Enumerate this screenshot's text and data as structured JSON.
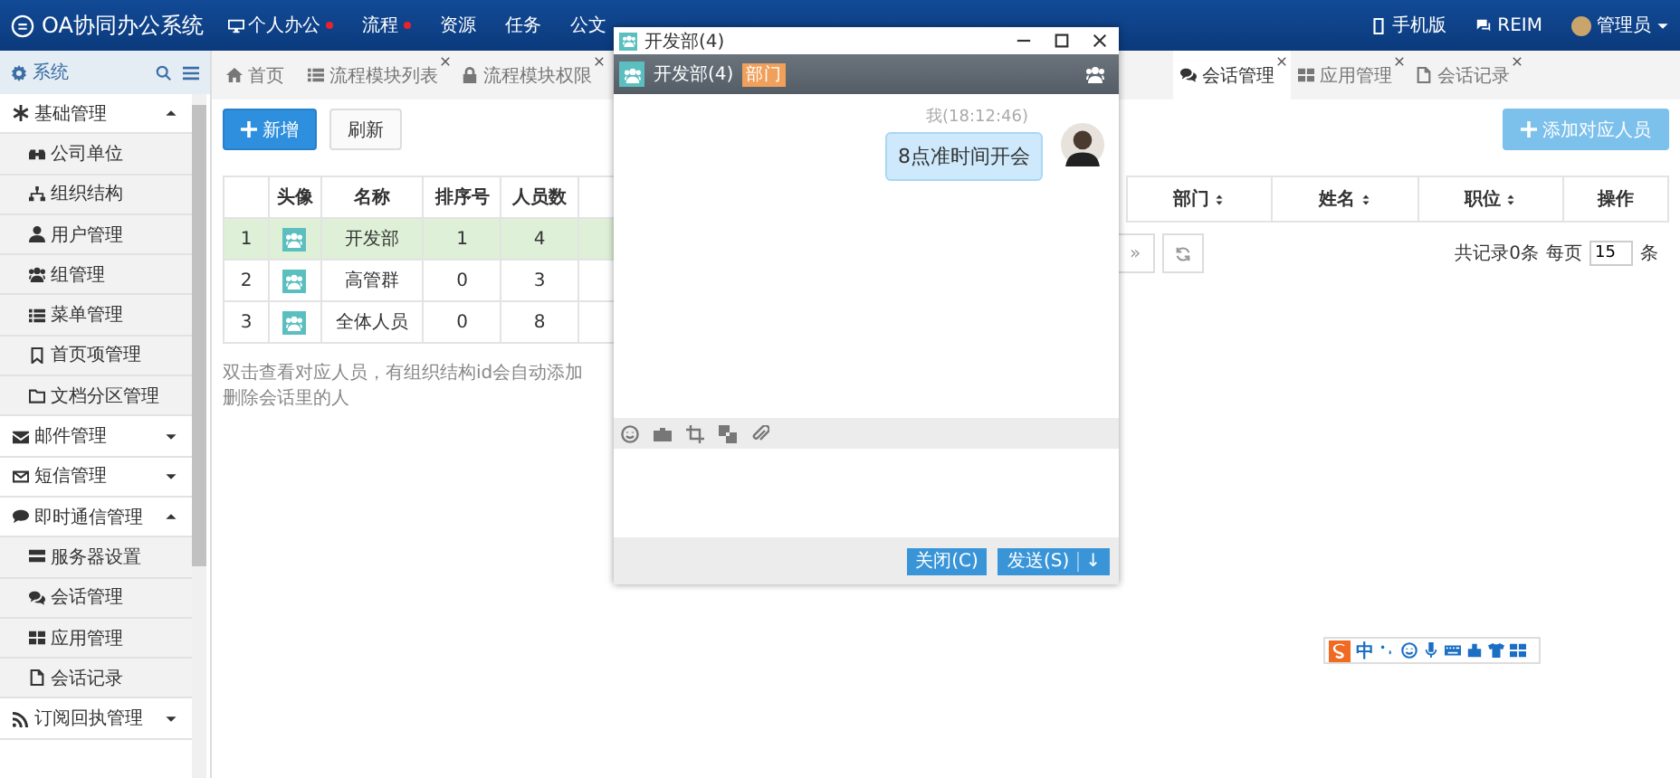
{
  "app": {
    "title": "OA协同办公系统"
  },
  "nav": [
    {
      "label": "个人办公",
      "dot": true,
      "selected": false
    },
    {
      "label": "流程",
      "dot": true,
      "selected": false
    },
    {
      "label": "资源",
      "dot": false,
      "selected": false
    },
    {
      "label": "任务",
      "dot": false,
      "selected": false
    },
    {
      "label": "公文",
      "dot": false,
      "selected": false
    }
  ],
  "top_right": [
    {
      "label": "手机版"
    },
    {
      "label": "REIM"
    },
    {
      "label": "管理员"
    }
  ],
  "sidebar": {
    "title": "系统",
    "groups": [
      {
        "label": "基础管理",
        "expanded": true,
        "children": [
          {
            "label": "公司单位"
          },
          {
            "label": "组织结构"
          },
          {
            "label": "用户管理"
          },
          {
            "label": "组管理"
          },
          {
            "label": "菜单管理"
          },
          {
            "label": "首页项管理"
          },
          {
            "label": "文档分区管理"
          }
        ]
      },
      {
        "label": "邮件管理",
        "expanded": false
      },
      {
        "label": "短信管理",
        "expanded": false
      },
      {
        "label": "即时通信管理",
        "expanded": true,
        "children": [
          {
            "label": "服务器设置"
          },
          {
            "label": "会话管理"
          },
          {
            "label": "应用管理"
          },
          {
            "label": "会话记录"
          }
        ]
      },
      {
        "label": "订阅回执管理",
        "expanded": false
      }
    ]
  },
  "tabs": [
    {
      "label": "首页",
      "closable": false,
      "selected": false
    },
    {
      "label": "流程模块列表",
      "closable": true,
      "selected": false
    },
    {
      "label": "流程模块权限",
      "closable": true,
      "selected": false
    },
    {
      "label": "会话管理",
      "closable": true,
      "selected": true
    },
    {
      "label": "应用管理",
      "closable": true,
      "selected": false
    },
    {
      "label": "会话记录",
      "closable": true,
      "selected": false
    }
  ],
  "left_panel": {
    "buttons": [
      {
        "label": "新增",
        "kind": "primary"
      },
      {
        "label": "刷新",
        "kind": "default"
      }
    ],
    "columns": [
      "头像",
      "名称",
      "排序号",
      "人员数"
    ],
    "rows": [
      {
        "index": "1",
        "name": "开发部",
        "sort": "1",
        "count": "4",
        "selected": true
      },
      {
        "index": "2",
        "name": "高管群",
        "sort": "0",
        "count": "3",
        "selected": false
      },
      {
        "index": "3",
        "name": "全体人员",
        "sort": "0",
        "count": "8",
        "selected": false
      }
    ],
    "note": "双击查看对应人员，有组织结构id会自动添加删除会话里的人"
  },
  "right_panel": {
    "add_button": {
      "label": "添加对应人员",
      "disabled": true
    },
    "columns": [
      {
        "label": "部门",
        "sortable": true
      },
      {
        "label": "姓名",
        "sortable": true
      },
      {
        "label": "职位",
        "sortable": true
      },
      {
        "label": "操作",
        "sortable": false
      }
    ],
    "pager": {
      "next": "»",
      "total": "共记录0条",
      "per_page": "每页",
      "page_size": "15",
      "unit": "条"
    }
  },
  "chat_window": {
    "title": "开发部(4)",
    "name": "开发部(4)",
    "badge": "部门",
    "messages": [
      {
        "sender": "我(18:12:46)",
        "text": "8点准时间开会",
        "mine": true
      }
    ],
    "buttons": [
      {
        "label": "关闭(C)"
      },
      {
        "label": "发送(S)",
        "menu": "↓"
      }
    ]
  },
  "ime": {
    "mode": "中"
  }
}
